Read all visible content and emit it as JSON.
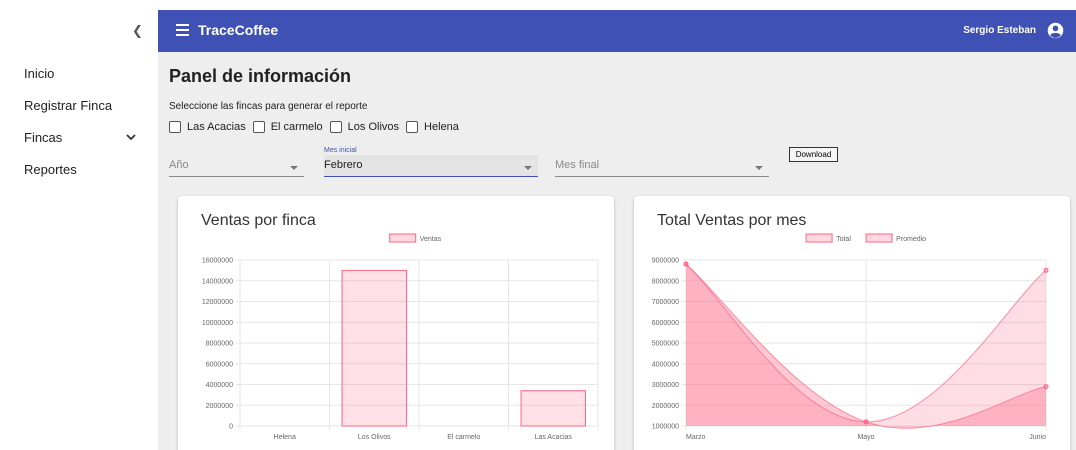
{
  "sidebar": {
    "collapse_icon": "chevron-left-icon",
    "items": [
      {
        "label": "Inicio"
      },
      {
        "label": "Registrar Finca"
      },
      {
        "label": "Fincas",
        "icon": "chevron-down-icon"
      },
      {
        "label": "Reportes"
      }
    ]
  },
  "appbar": {
    "title": "TraceCoffee",
    "user": "Sergio Esteban",
    "color": "#3f51b5"
  },
  "page": {
    "title": "Panel de información",
    "subtitle": "Seleccione las fincas para generar el reporte",
    "farms": [
      "Las Acacias",
      "El carmelo",
      "Los Olivos",
      "Helena"
    ]
  },
  "filters": {
    "year_placeholder": "Año",
    "start_month_label": "Mes inicial",
    "start_month_value": "Febrero",
    "end_month_placeholder": "Mes final",
    "download_label": "Download"
  },
  "chart_data": [
    {
      "type": "bar",
      "title": "Ventas por finca",
      "categories": [
        "Helena",
        "Los Olivos",
        "El carmelo",
        "Las Acacias"
      ],
      "series": [
        {
          "name": "Ventas",
          "values": [
            0,
            15000000,
            0,
            3400000
          ]
        }
      ],
      "ylim": [
        0,
        16000000
      ],
      "yticks": [
        "16000000",
        "14000000",
        "12000000",
        "10000000",
        "8000000",
        "6000000",
        "4000000",
        "2000000",
        "0"
      ],
      "legend": "top-center",
      "grid": true,
      "color": "#ff6384"
    },
    {
      "type": "area",
      "title": "Total Ventas por mes",
      "categories": [
        "Marzo",
        "Mayo",
        "Junio"
      ],
      "series": [
        {
          "name": "Total",
          "values": [
            8800000,
            1200000,
            8500000
          ]
        },
        {
          "name": "Promedio",
          "values": [
            8800000,
            1200000,
            2900000
          ]
        }
      ],
      "ylim": [
        1000000,
        9000000
      ],
      "yticks": [
        "9000000",
        "8000000",
        "7000000",
        "6000000",
        "5000000",
        "4000000",
        "3000000",
        "2000000",
        "1000000"
      ],
      "legend": "top-center",
      "grid": true,
      "color": "#ff6384"
    }
  ]
}
